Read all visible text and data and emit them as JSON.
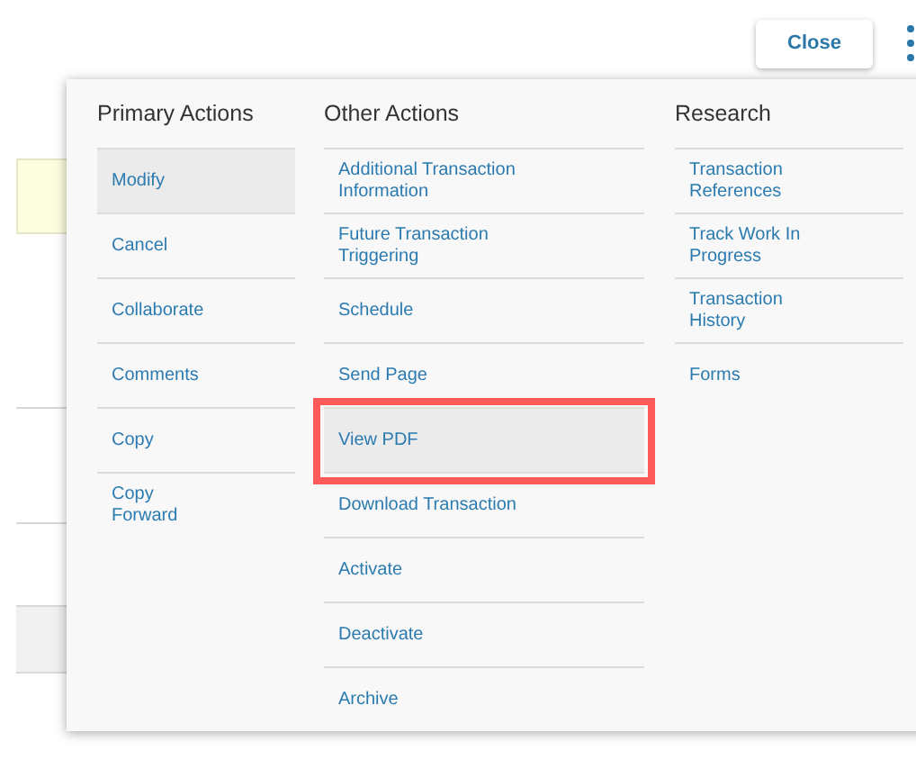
{
  "header": {
    "close_button": "Close"
  },
  "menu": {
    "columns": [
      {
        "title": "Primary Actions",
        "items": [
          {
            "label": "Modify",
            "highlighted": true,
            "outlined": false
          },
          {
            "label": "Cancel",
            "highlighted": false,
            "outlined": false
          },
          {
            "label": "Collaborate",
            "highlighted": false,
            "outlined": false
          },
          {
            "label": "Comments",
            "highlighted": false,
            "outlined": false
          },
          {
            "label": "Copy",
            "highlighted": false,
            "outlined": false
          },
          {
            "label": "Copy Forward",
            "highlighted": false,
            "outlined": false
          }
        ]
      },
      {
        "title": "Other Actions",
        "items": [
          {
            "label": "Additional Transaction Information",
            "highlighted": false,
            "outlined": false
          },
          {
            "label": "Future Transaction Triggering",
            "highlighted": false,
            "outlined": false
          },
          {
            "label": "Schedule",
            "highlighted": false,
            "outlined": false
          },
          {
            "label": "Send Page",
            "highlighted": false,
            "outlined": false
          },
          {
            "label": "View PDF",
            "highlighted": true,
            "outlined": true
          },
          {
            "label": "Download Transaction",
            "highlighted": false,
            "outlined": false
          },
          {
            "label": "Activate",
            "highlighted": false,
            "outlined": false
          },
          {
            "label": "Deactivate",
            "highlighted": false,
            "outlined": false
          },
          {
            "label": "Archive",
            "highlighted": false,
            "outlined": false
          }
        ]
      },
      {
        "title": "Research",
        "items": [
          {
            "label": "Transaction References",
            "highlighted": false,
            "outlined": false
          },
          {
            "label": "Track Work In Progress",
            "highlighted": false,
            "outlined": false
          },
          {
            "label": "Transaction History",
            "highlighted": false,
            "outlined": false
          },
          {
            "label": "Forms",
            "highlighted": false,
            "outlined": false
          }
        ]
      }
    ]
  }
}
